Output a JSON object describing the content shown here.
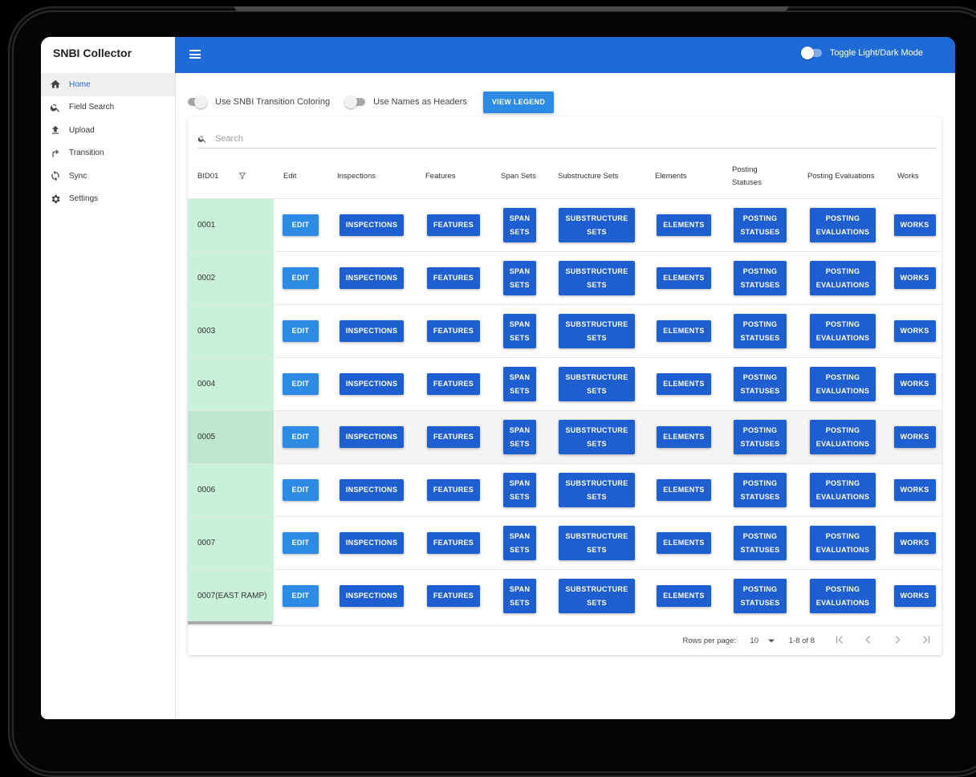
{
  "app": {
    "title": "SNBI Collector"
  },
  "colors": {
    "accent": "#1e6bd8",
    "button": "#1e5ed0",
    "edit_button": "#2d8be5",
    "bid_cell": "#c9f0d9"
  },
  "sidebar": {
    "items": [
      {
        "label": "Home",
        "icon": "home-icon",
        "active": true
      },
      {
        "label": "Field Search",
        "icon": "search-icon"
      },
      {
        "label": "Upload",
        "icon": "upload-icon"
      },
      {
        "label": "Transition",
        "icon": "transition-arrow-icon"
      },
      {
        "label": "Sync",
        "icon": "sync-icon"
      },
      {
        "label": "Settings",
        "icon": "gear-icon"
      }
    ]
  },
  "appbar": {
    "toggle_label": "Toggle Light/Dark Mode"
  },
  "controls": {
    "transition_coloring_label": "Use SNBI Transition Coloring",
    "names_as_headers_label": "Use Names as Headers",
    "view_legend_label": "VIEW LEGEND"
  },
  "search": {
    "placeholder": "Search"
  },
  "table": {
    "headers": [
      "BID01",
      "Edit",
      "Inspections",
      "Features",
      "Span Sets",
      "Substructure Sets",
      "Elements",
      "Posting Statuses",
      "Posting Evaluations",
      "Works"
    ],
    "buttons": {
      "edit": "EDIT",
      "inspections": "INSPECTIONS",
      "features": "FEATURES",
      "span_sets_1": "SPAN",
      "span_sets_2": "SETS",
      "substructure_1": "SUBSTRUCTURE",
      "substructure_2": "SETS",
      "elements": "ELEMENTS",
      "posting_statuses_1": "POSTING",
      "posting_statuses_2": "STATUSES",
      "posting_evaluations_1": "POSTING",
      "posting_evaluations_2": "EVALUATIONS",
      "works": "WORKS"
    },
    "rows": [
      "0001",
      "0002",
      "0003",
      "0004",
      "0005",
      "0006",
      "0007",
      "0007(EAST RAMP)"
    ]
  },
  "pagination": {
    "rows_per_page_label": "Rows per page:",
    "rows_per_page": "10",
    "range": "1-8 of 8"
  }
}
